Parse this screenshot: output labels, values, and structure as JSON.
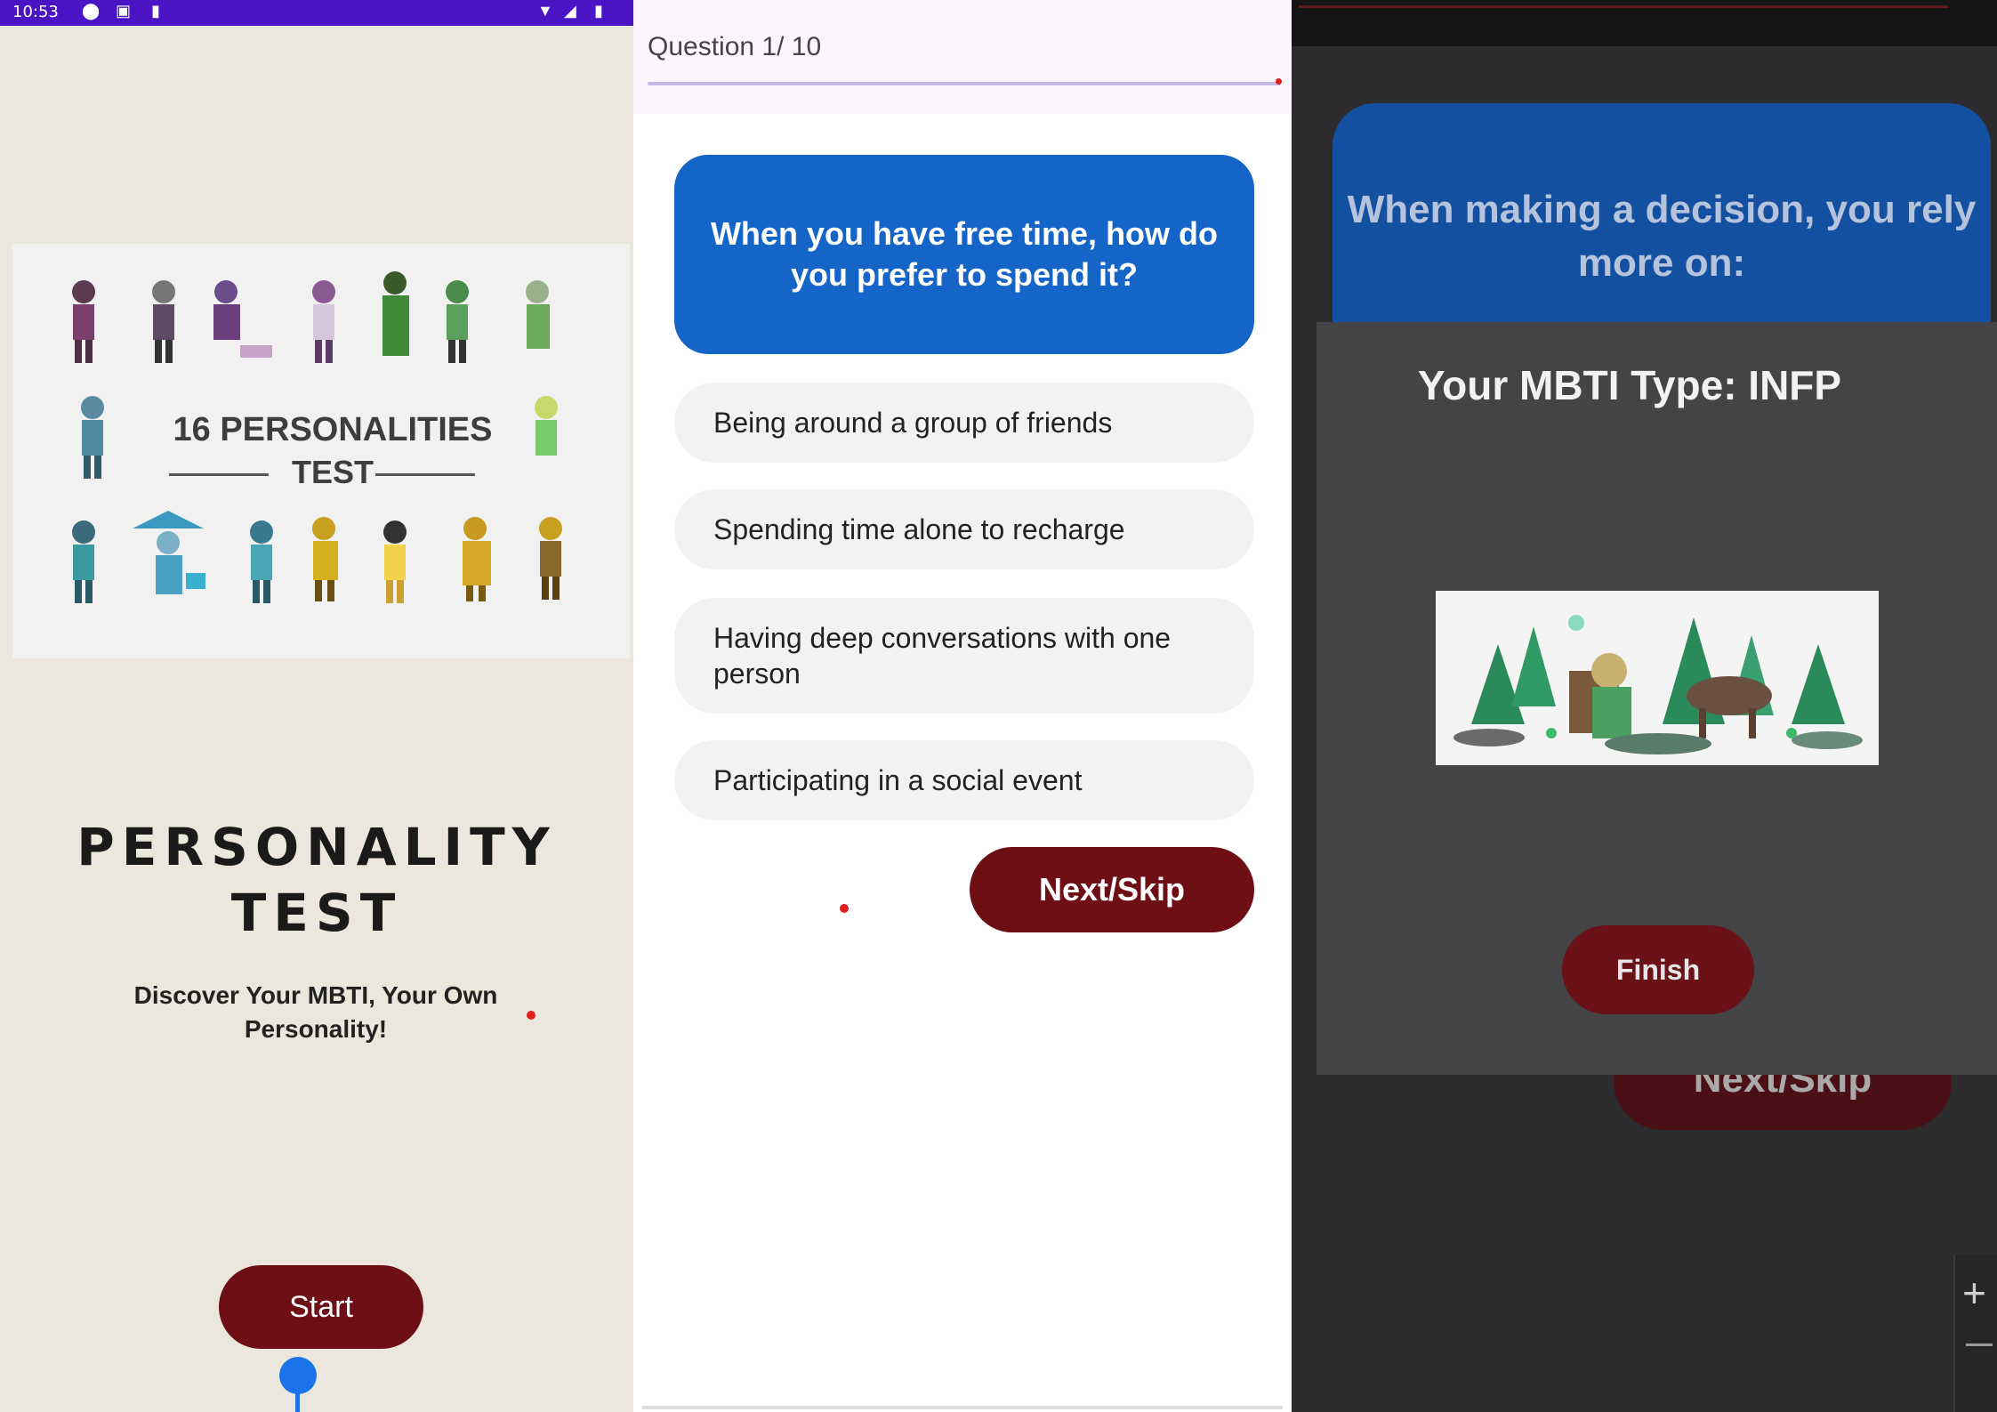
{
  "welcome_screen": {
    "status_time": "10:53",
    "banner_title_line1": "16 PERSONALITIES",
    "banner_title_line2": "TEST",
    "title_line1": "PERSONALITY",
    "title_line2": "TEST",
    "subtitle_line1": "Discover Your MBTI, Your Own",
    "subtitle_line2": "Personality!",
    "start_label": "Start",
    "colors": {
      "status_bar": "#4a14c4",
      "background": "#ebe7dc",
      "button": "#6e0f16"
    }
  },
  "question_screen": {
    "question_counter": "Question 1/ 10",
    "question_text": "When you have free time, how do you prefer to spend it?",
    "options": [
      "Being around a group of friends",
      "Spending time alone to recharge",
      "Having deep conversations with one person",
      "Participating in a social event"
    ],
    "next_label": "Next/Skip",
    "colors": {
      "question_card": "#1565c8",
      "option_bg": "#f2f2f2",
      "button": "#6e0f16"
    }
  },
  "result_screen": {
    "background_question": "When making a decision, you rely more on:",
    "result_title": "Your MBTI Type: INFP",
    "finish_label": "Finish",
    "background_next_label": "Next/Skip",
    "colors": {
      "overlay": "#444446",
      "button": "#6b1218"
    }
  }
}
